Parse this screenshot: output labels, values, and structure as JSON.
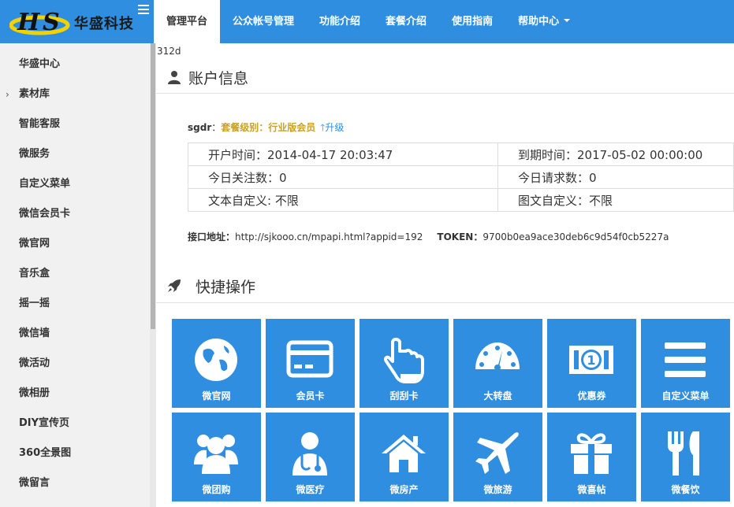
{
  "brand": {
    "name": "华盛科技"
  },
  "nav": [
    {
      "label": "管理平台",
      "active": true
    },
    {
      "label": "公众帐号管理"
    },
    {
      "label": "功能介绍"
    },
    {
      "label": "套餐介绍"
    },
    {
      "label": "使用指南"
    },
    {
      "label": "帮助中心",
      "dropdown": true
    }
  ],
  "sidebar": [
    {
      "label": "华盛中心"
    },
    {
      "label": "素材库",
      "arrow": "›"
    },
    {
      "label": "智能客服"
    },
    {
      "label": "微服务"
    },
    {
      "label": "自定义菜单"
    },
    {
      "label": "微信会员卡"
    },
    {
      "label": "微官网"
    },
    {
      "label": "音乐盒"
    },
    {
      "label": "摇一摇"
    },
    {
      "label": "微信墙"
    },
    {
      "label": "微活动"
    },
    {
      "label": "微相册"
    },
    {
      "label": "DIY宣传页"
    },
    {
      "label": "360全景图"
    },
    {
      "label": "微留言"
    }
  ],
  "main": {
    "crumb": "312d",
    "account_title": "账户信息",
    "user": "sgdr",
    "colon": "：",
    "level": "套餐级别：行业版会员",
    "upgrade": "升级",
    "info": {
      "open_time": "开户时间：2014-04-17 20:03:47",
      "expire_time": "到期时间：2017-05-02 00:00:00",
      "follow_today": "今日关注数：0",
      "request_today": "今日请求数：0",
      "text_custom": "文本自定义: 不限",
      "news_custom": "图文自定义：不限"
    },
    "api_label": "接口地址：",
    "api_url": "http://sjkooo.cn/mpapi.html?appid=192",
    "token_label": "TOKEN：",
    "token_value": "9700b0ea9ace30deb6c9d54f0cb5227a",
    "quick_title": "快捷操作"
  },
  "tiles": [
    {
      "label": "微官网",
      "icon": "globe-icon"
    },
    {
      "label": "会员卡",
      "icon": "card-icon"
    },
    {
      "label": "刮刮卡",
      "icon": "hand-pointer-icon"
    },
    {
      "label": "大转盘",
      "icon": "dashboard-icon"
    },
    {
      "label": "优惠券",
      "icon": "banknote-icon"
    },
    {
      "label": "自定义菜单",
      "icon": "menu-icon"
    },
    {
      "label": "微团购",
      "icon": "group-icon"
    },
    {
      "label": "微医疗",
      "icon": "doctor-icon"
    },
    {
      "label": "微房产",
      "icon": "house-icon"
    },
    {
      "label": "微旅游",
      "icon": "plane-icon"
    },
    {
      "label": "微喜帖",
      "icon": "gift-icon"
    },
    {
      "label": "微餐饮",
      "icon": "cutlery-icon"
    }
  ],
  "colors": {
    "accent": "#2f8ee0",
    "level": "#c9a227",
    "sidebar_bg": "#f1f1f1"
  }
}
